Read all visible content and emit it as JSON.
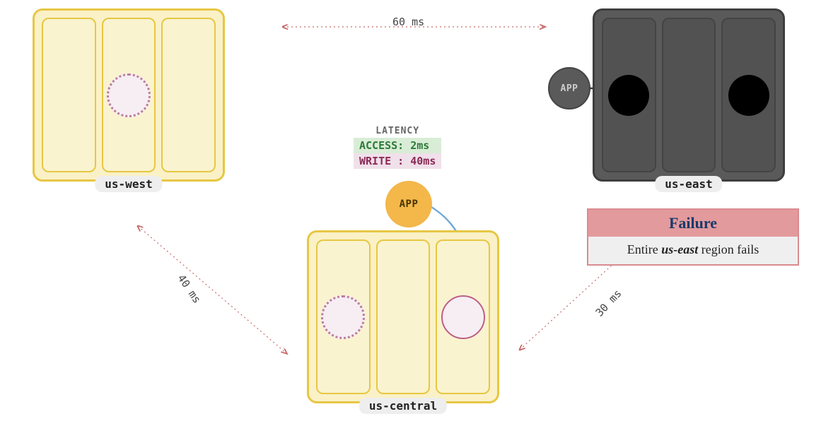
{
  "regions": {
    "west": {
      "label": "us-west"
    },
    "central": {
      "label": "us-central"
    },
    "east": {
      "label": "us-east"
    }
  },
  "apps": {
    "central": {
      "label": "APP"
    },
    "east": {
      "label": "APP"
    }
  },
  "latency": {
    "title": "LATENCY",
    "access": "ACCESS: 2ms",
    "write": "WRITE : 40ms"
  },
  "links": {
    "westToEast": {
      "label": "60 ms"
    },
    "westToCentral": {
      "label": "40 ms"
    },
    "centralToEast": {
      "label": "30 ms"
    }
  },
  "failure": {
    "title": "Failure",
    "body_pre": "Entire ",
    "body_em": "us-east",
    "body_post": " region fails"
  }
}
